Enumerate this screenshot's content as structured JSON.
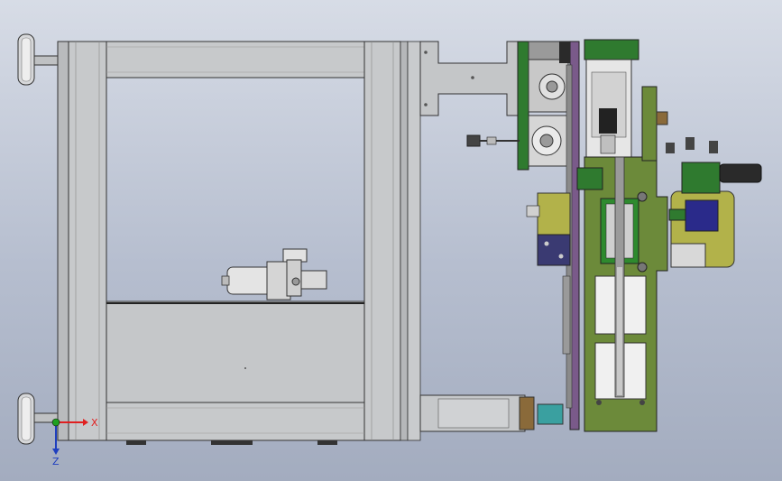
{
  "viewport": {
    "background_top": "#d7dce6",
    "background_bottom": "#a3acbf",
    "model_colors": {
      "frame_gray": "#c4c6c8",
      "frame_edge": "#3a3a3a",
      "plate_green": "#6c8a3a",
      "plate_dark_green": "#2f7a2f",
      "olive": "#b2b24a",
      "purple": "#7a5a8a",
      "navy": "#2a2a8a",
      "motor_silver": "#dcdcdc",
      "brown": "#8a6a3a",
      "cyan": "#3aa0a0"
    }
  },
  "triad": {
    "x_label": "X",
    "z_label": "Z",
    "x_color": "#e02020",
    "z_color": "#1f3fbf",
    "origin_color": "#20a020"
  }
}
